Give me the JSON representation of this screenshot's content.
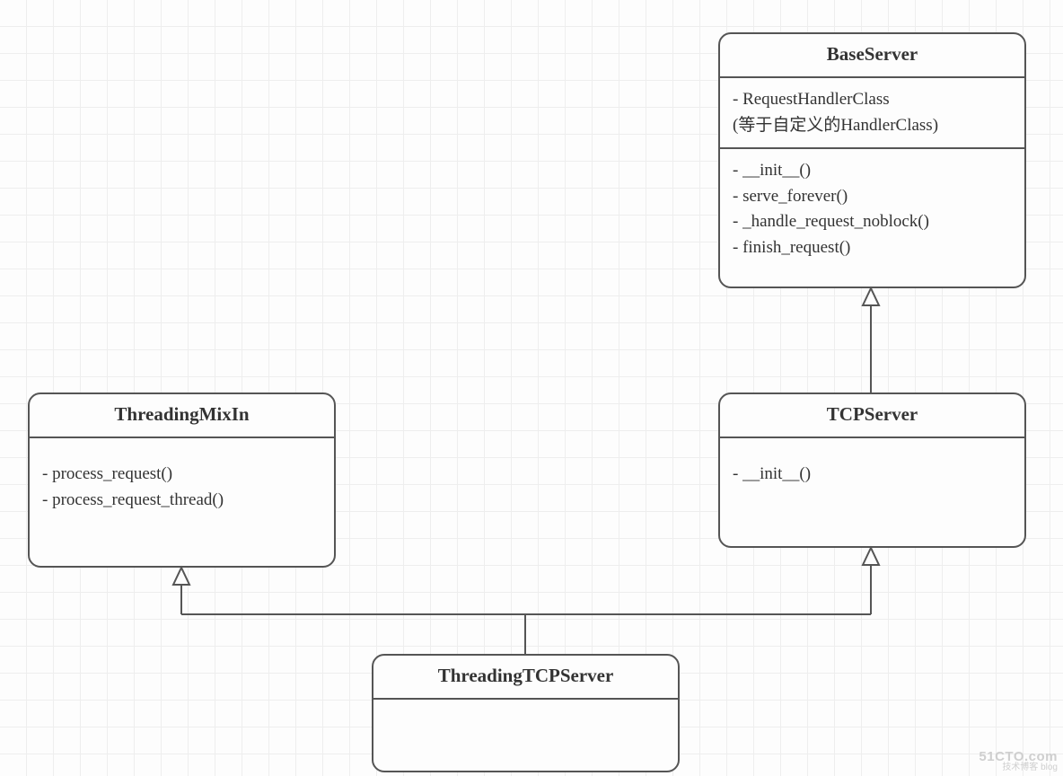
{
  "diagram": {
    "type": "uml-class",
    "classes": {
      "baseServer": {
        "name": "BaseServer",
        "attributes": [
          "- RequestHandlerClass",
          "  (等于自定义的HandlerClass)"
        ],
        "methods": [
          "- __init__()",
          "- serve_forever()",
          "- _handle_request_noblock()",
          "- finish_request()"
        ]
      },
      "threadingMixIn": {
        "name": "ThreadingMixIn",
        "methods": [
          "- process_request()",
          "- process_request_thread()"
        ]
      },
      "tcpServer": {
        "name": "TCPServer",
        "methods": [
          "- __init__()"
        ]
      },
      "threadingTCPServer": {
        "name": "ThreadingTCPServer"
      }
    },
    "edges": [
      {
        "from": "tcpServer",
        "to": "baseServer",
        "kind": "inherits"
      },
      {
        "from": "threadingTCPServer",
        "to": "threadingMixIn",
        "kind": "inherits"
      },
      {
        "from": "threadingTCPServer",
        "to": "tcpServer",
        "kind": "inherits"
      }
    ]
  },
  "watermark": {
    "line1": "51CTO.com",
    "line2": "技术博客  blog"
  }
}
